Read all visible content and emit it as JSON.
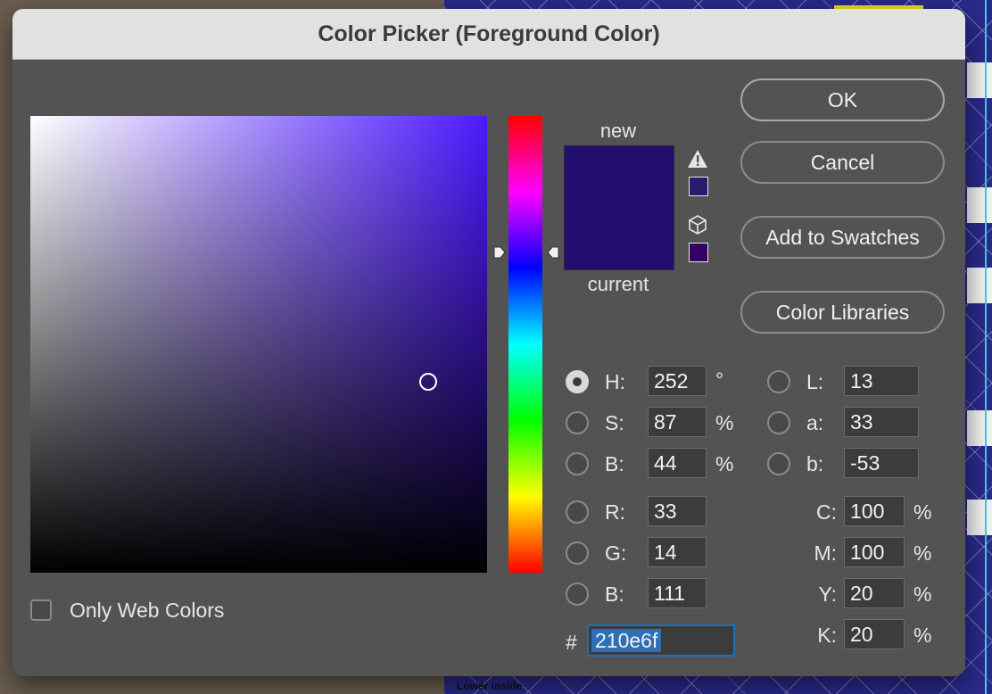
{
  "window": {
    "title": "Color Picker (Foreground Color)"
  },
  "colors": {
    "current_color": "#210e6f",
    "new_color": "#210e6f",
    "hue_base": "#4d1aff",
    "gamut_warning_swatch": "#2a1a6f",
    "web_safe_swatch": "#330066",
    "hex_selection": "#2f6fb3"
  },
  "preview": {
    "new_label": "new",
    "current_label": "current"
  },
  "icons": {
    "gamut_warning": "warning-triangle-icon",
    "web_safe": "cube-icon"
  },
  "buttons": {
    "ok": "OK",
    "cancel": "Cancel",
    "add_to_swatches": "Add to Swatches",
    "color_libraries": "Color Libraries"
  },
  "hsb": {
    "h": {
      "label": "H:",
      "value": "252",
      "unit": "°",
      "selected": true
    },
    "s": {
      "label": "S:",
      "value": "87",
      "unit": "%"
    },
    "b": {
      "label": "B:",
      "value": "44",
      "unit": "%"
    }
  },
  "rgb": {
    "r": {
      "label": "R:",
      "value": "33"
    },
    "g": {
      "label": "G:",
      "value": "14"
    },
    "b": {
      "label": "B:",
      "value": "111"
    }
  },
  "lab": {
    "l": {
      "label": "L:",
      "value": "13"
    },
    "a": {
      "label": "a:",
      "value": "33"
    },
    "b": {
      "label": "b:",
      "value": "-53"
    }
  },
  "cmyk": {
    "c": {
      "label": "C:",
      "value": "100",
      "unit": "%"
    },
    "m": {
      "label": "M:",
      "value": "100",
      "unit": "%"
    },
    "y": {
      "label": "Y:",
      "value": "20",
      "unit": "%"
    },
    "k": {
      "label": "K:",
      "value": "20",
      "unit": "%"
    }
  },
  "hex": {
    "prefix": "#",
    "value": "210e6f"
  },
  "only_web_colors": {
    "label": "Only Web Colors",
    "checked": false
  },
  "background": {
    "document_text": "Lower inside"
  }
}
